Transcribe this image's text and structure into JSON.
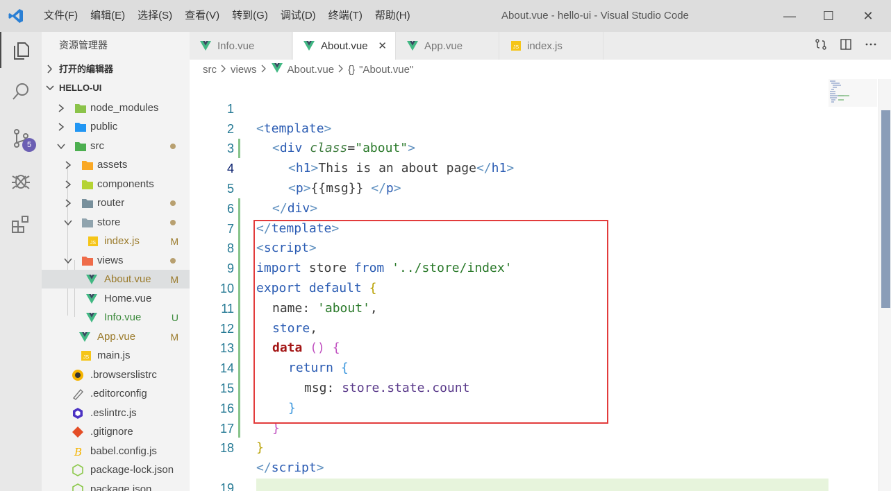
{
  "menu": [
    "文件(F)",
    "编辑(E)",
    "选择(S)",
    "查看(V)",
    "转到(G)",
    "调试(D)",
    "终端(T)",
    "帮助(H)"
  ],
  "window_title": "About.vue - hello-ui - Visual Studio Code",
  "window_controls": {
    "minimize": "—",
    "maximize": "☐",
    "close": "✕"
  },
  "activity": {
    "scm_badge": "5"
  },
  "sidebar": {
    "title": "资源管理器",
    "open_editors": "打开的编辑器",
    "project": "HELLO-UI",
    "tree": [
      {
        "label": "node_modules",
        "status": ""
      },
      {
        "label": "public",
        "status": ""
      },
      {
        "label": "src",
        "status": ""
      },
      {
        "label": "assets",
        "status": ""
      },
      {
        "label": "components",
        "status": ""
      },
      {
        "label": "router",
        "status": ""
      },
      {
        "label": "store",
        "status": ""
      },
      {
        "label": "index.js",
        "status": "M"
      },
      {
        "label": "views",
        "status": ""
      },
      {
        "label": "About.vue",
        "status": "M"
      },
      {
        "label": "Home.vue",
        "status": ""
      },
      {
        "label": "Info.vue",
        "status": "U"
      },
      {
        "label": "App.vue",
        "status": "M"
      },
      {
        "label": "main.js",
        "status": ""
      },
      {
        "label": ".browserslistrc",
        "status": ""
      },
      {
        "label": ".editorconfig",
        "status": ""
      },
      {
        "label": ".eslintrc.js",
        "status": ""
      },
      {
        "label": ".gitignore",
        "status": ""
      },
      {
        "label": "babel.config.js",
        "status": ""
      },
      {
        "label": "package-lock.json",
        "status": ""
      },
      {
        "label": "package.json",
        "status": ""
      }
    ]
  },
  "tabs": [
    {
      "label": "Info.vue"
    },
    {
      "label": "About.vue",
      "close": "✕"
    },
    {
      "label": "App.vue"
    },
    {
      "label": "index.js"
    }
  ],
  "breadcrumb": {
    "p1": "src",
    "p2": "views",
    "p3": "About.vue",
    "p4": "{}",
    "p5": "\"About.vue\""
  },
  "line_numbers": [
    "1",
    "2",
    "3",
    "4",
    "5",
    "6",
    "7",
    "8",
    "9",
    "10",
    "11",
    "12",
    "13",
    "14",
    "15",
    "16",
    "17",
    "18",
    "19"
  ],
  "code": {
    "l1": [
      "<",
      "template",
      ">"
    ],
    "l2": [
      "<",
      "div",
      "class",
      "=",
      "\"about\"",
      ">"
    ],
    "l3": [
      "<",
      "h1",
      ">",
      "This is an about page",
      "</",
      "h1",
      ">"
    ],
    "l4": [
      "<",
      "p",
      ">",
      "{{msg}}",
      " </",
      "p",
      ">"
    ],
    "l5": [
      "</",
      "div",
      ">"
    ],
    "l6": [
      "</",
      "template",
      ">"
    ],
    "l7": [
      "<",
      "script",
      ">"
    ],
    "l8": [
      "import",
      "store",
      "from",
      "'../store/index'"
    ],
    "l9": [
      "export",
      "default",
      "{"
    ],
    "l10": [
      "name",
      ":",
      "'about'",
      ","
    ],
    "l11": [
      "store",
      ","
    ],
    "l12": [
      "data",
      "()",
      "{"
    ],
    "l13": [
      "return",
      "{"
    ],
    "l14": [
      "msg",
      ":",
      "store.state.count"
    ],
    "l15": [
      "}"
    ],
    "l16": [
      "}"
    ],
    "l17": [
      "}"
    ],
    "l18": [
      "</",
      "script",
      ">"
    ]
  },
  "colors": {
    "highlight_box": "#e23b3b",
    "vue_green": "#41b883",
    "js_yellow": "#f5c518",
    "scm_badge": "#6b5fb3"
  }
}
